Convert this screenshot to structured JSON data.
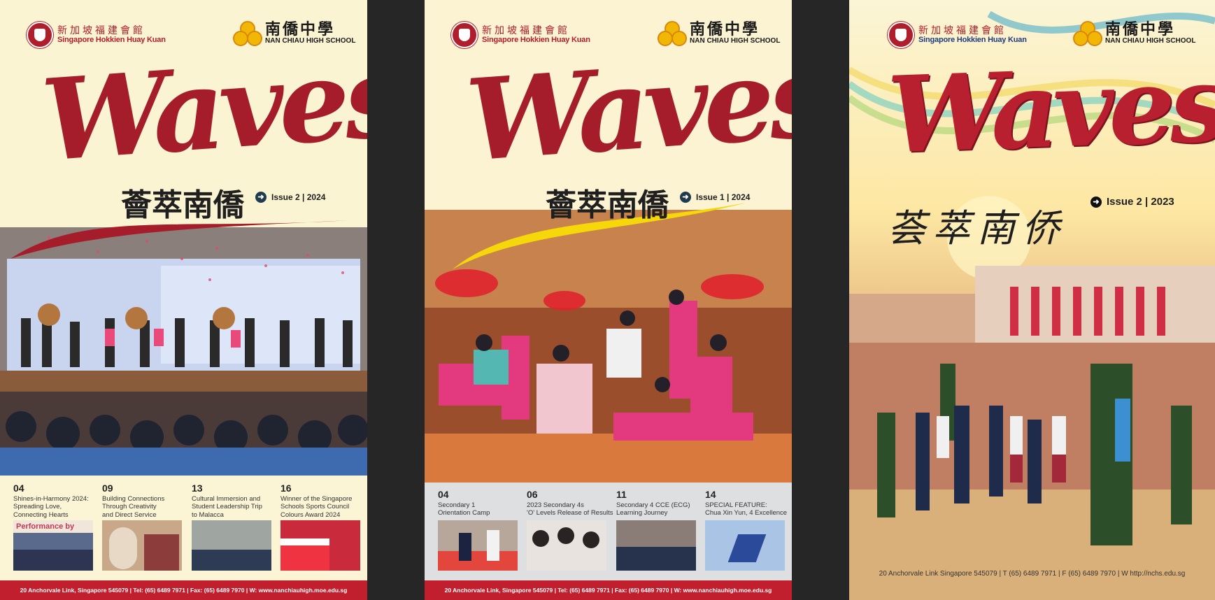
{
  "covers": [
    {
      "publisher_cn": "新加坡福建會館",
      "publisher_en": "Singapore Hokkien Huay Kuan",
      "school_cn": "南僑中學",
      "school_en": "NAN CHIAU HIGH SCHOOL",
      "title": "Waves",
      "subtitle_cn": "薈萃南僑",
      "issue": "Issue 2 | 2024",
      "contents": [
        {
          "num": "04",
          "title": "Shines-in-Harmony 2024:\nSpreading Love,\nConnecting Hearts"
        },
        {
          "num": "09",
          "title": "Building Connections\nThrough Creativity\nand Direct Service"
        },
        {
          "num": "13",
          "title": "Cultural Immersion and\nStudent Leadership Trip\nto Malacca"
        },
        {
          "num": "16",
          "title": "Winner of the Singapore\nSchools Sports Council\nColours Award 2024"
        }
      ],
      "thumb_text": "Performance by",
      "footer": "20 Anchorvale Link, Singapore 545079  |  Tel: (65) 6489 7971  |  Fax: (65) 6489 7970  |  W: www.nanchiauhigh.moe.edu.sg"
    },
    {
      "publisher_cn": "新加坡福建會館",
      "publisher_en": "Singapore Hokkien Huay Kuan",
      "school_cn": "南僑中學",
      "school_en": "NAN CHIAU HIGH SCHOOL",
      "title": "Waves",
      "subtitle_cn": "薈萃南僑",
      "issue": "Issue 1 | 2024",
      "contents": [
        {
          "num": "04",
          "title": "Secondary 1\nOrientation Camp"
        },
        {
          "num": "06",
          "title": "2023 Secondary 4s\n'O' Levels Release of Results"
        },
        {
          "num": "11",
          "title": "Secondary 4 CCE (ECG)\nLearning Journey"
        },
        {
          "num": "14",
          "title": "SPECIAL FEATURE:\nChua Xin Yun, 4 Excellence"
        }
      ],
      "footer": "20 Anchorvale Link, Singapore 545079  |  Tel: (65) 6489 7971  |  Fax: (65) 6489 7970  |  W: www.nanchiauhigh.moe.edu.sg"
    },
    {
      "publisher_cn": "新加坡福建會館",
      "publisher_en": "Singapore Hokkien Huay Kuan",
      "school_cn": "南僑中學",
      "school_en": "NAN CHIAU HIGH SCHOOL",
      "title": "Waves",
      "subtitle_cn": "荟萃南侨",
      "issue": "Issue 2 | 2023",
      "footer": "20 Anchorvale Link Singapore 545079  |  T (65) 6489 7971  |  F (65) 6489 7970  |  W http://nchs.edu.sg"
    }
  ],
  "colors": {
    "brand_red": "#a51d2b",
    "footer_red": "#c21f2e",
    "divider_dark": "#262626",
    "cream": "#fbf5d6"
  }
}
